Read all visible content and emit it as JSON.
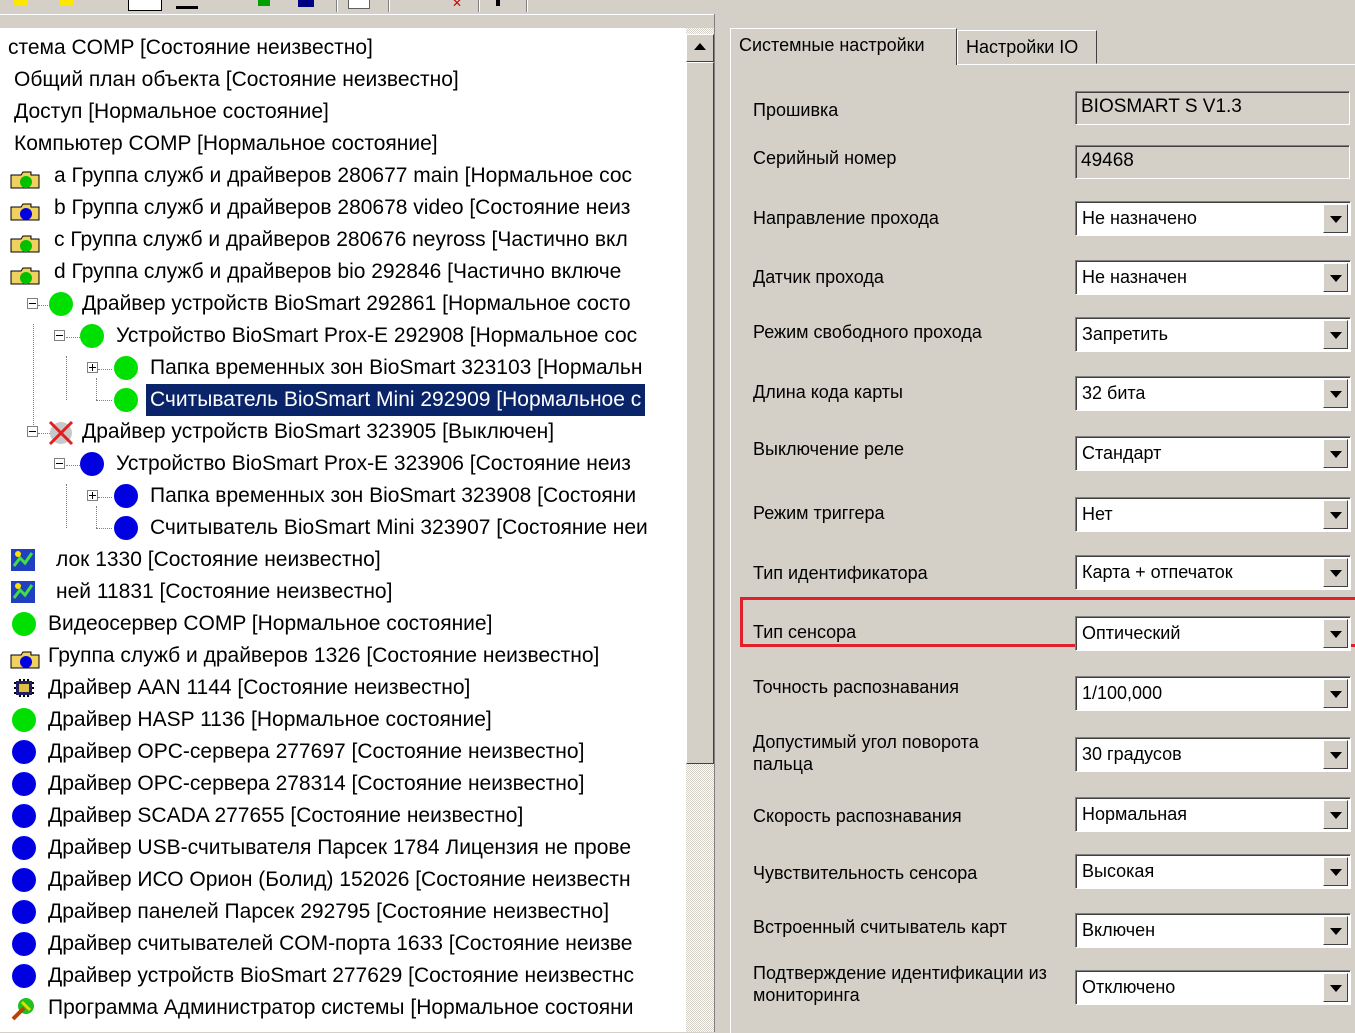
{
  "tree": {
    "items": [
      {
        "label": "стема COMP [Состояние неизвестно]"
      },
      {
        "label": "Общий план объекта [Состояние неизвестно]"
      },
      {
        "label": "Доступ [Нормальное состояние]"
      },
      {
        "label": "Компьютер COMP [Нормальное состояние]"
      },
      {
        "label": "a Группа служб и драйверов 280677 main [Нормальное сос"
      },
      {
        "label": "b Группа служб и драйверов 280678 video [Состояние неиз"
      },
      {
        "label": "c Группа служб и драйверов 280676 neyross [Частично вкл"
      },
      {
        "label": "d Группа служб и драйверов bio 292846 [Частично включе"
      },
      {
        "label": "Драйвер устройств BioSmart 292861 [Нормальное состо"
      },
      {
        "label": "Устройство BioSmart Prox-E 292908 [Нормальное сос"
      },
      {
        "label": "Папка временных зон BioSmart 323103 [Нормальн"
      },
      {
        "label": "Считыватель BioSmart Mini 292909 [Нормальное с"
      },
      {
        "label": "Драйвер устройств BioSmart 323905 [Выключен]"
      },
      {
        "label": "Устройство BioSmart Prox-E 323906 [Состояние неиз"
      },
      {
        "label": "Папка временных зон BioSmart 323908 [Состояни"
      },
      {
        "label": "Считыватель BioSmart Mini 323907 [Состояние неи"
      },
      {
        "label": "лок 1330 [Состояние неизвестно]"
      },
      {
        "label": "ней 11831 [Состояние неизвестно]"
      },
      {
        "label": "Видеосервер COMP [Нормальное состояние]"
      },
      {
        "label": "Группа служб и драйверов 1326 [Состояние неизвестно]"
      },
      {
        "label": "Драйвер AAN 1144 [Состояние неизвестно]"
      },
      {
        "label": "Драйвер HASP 1136 [Нормальное состояние]"
      },
      {
        "label": "Драйвер OPC-сервера 277697 [Состояние неизвестно]"
      },
      {
        "label": "Драйвер OPC-сервера 278314 [Состояние неизвестно]"
      },
      {
        "label": "Драйвер SCADA 277655 [Состояние неизвестно]"
      },
      {
        "label": "Драйвер USB-считывателя Парсек 1784 Лицензия не прове"
      },
      {
        "label": "Драйвер ИСО Орион (Болид) 152026 [Состояние неизвестн"
      },
      {
        "label": "Драйвер панелей Парсек 292795 [Состояние неизвестно]"
      },
      {
        "label": "Драйвер считывателей COM-порта 1633 [Состояние неизве"
      },
      {
        "label": "Драйвер устройств BioSmart 277629 [Состояние неизвестнс"
      },
      {
        "label": "Программа Администратор системы [Нормальное состояни"
      }
    ]
  },
  "tabs": [
    {
      "label": "Системные настройки"
    },
    {
      "label": "Настройки IO"
    }
  ],
  "settings": {
    "firmware": {
      "label": "Прошивка",
      "value": "BIOSMART S V1.3"
    },
    "serial": {
      "label": "Серийный номер",
      "value": "49468"
    },
    "direction": {
      "label": "Направление прохода",
      "value": "Не назначено"
    },
    "sensor_pass": {
      "label": "Датчик прохода",
      "value": "Не назначен"
    },
    "free_pass": {
      "label": "Режим свободного прохода",
      "value": "Запретить"
    },
    "code_length": {
      "label": "Длина кода карты",
      "value": "32 бита"
    },
    "relay_off": {
      "label": "Выключение реле",
      "value": "Стандарт"
    },
    "trigger_mode": {
      "label": "Режим триггера",
      "value": "Нет"
    },
    "id_type": {
      "label": "Тип идентификатора",
      "value": "Карта + отпечаток"
    },
    "sensor_type": {
      "label": "Тип сенсора",
      "value": "Оптический"
    },
    "accuracy": {
      "label": "Точность распознавания",
      "value": "1/100,000"
    },
    "rotation": {
      "label": "Допустимый угол поворота пальца",
      "value": "30 градусов"
    },
    "speed": {
      "label": "Скорость распознавания",
      "value": "Нормальная"
    },
    "sensitivity": {
      "label": "Чувствительность сенсора",
      "value": "Высокая"
    },
    "card_reader": {
      "label": "Встроенный считыватель карт",
      "value": "Включен"
    },
    "confirm": {
      "label": "Подтверждение идентификации из мониторинга",
      "value": "Отключено"
    }
  }
}
